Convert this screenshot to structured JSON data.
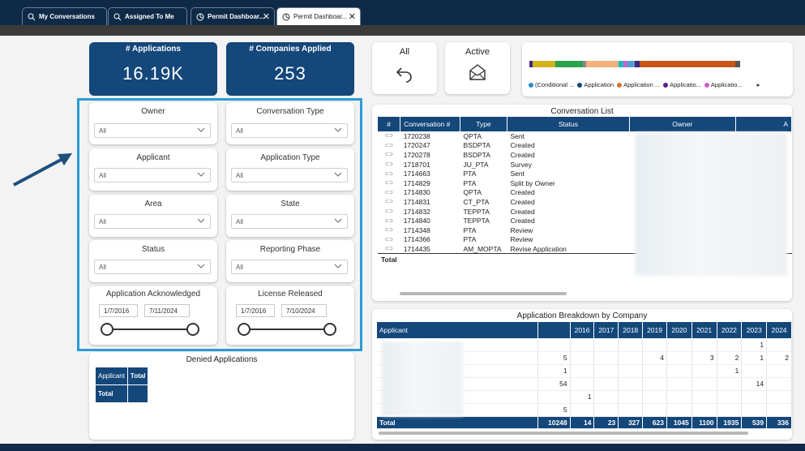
{
  "tabs": [
    {
      "label": "My Conversations",
      "icon": "search-icon"
    },
    {
      "label": "Assigned To Me",
      "icon": "search-icon"
    },
    {
      "label": "Permit Dashboar...",
      "icon": "dashboard-icon"
    },
    {
      "label": "Permit Dashboar...",
      "icon": "dashboard-icon"
    }
  ],
  "kpis": {
    "applications": {
      "label": "# Applications",
      "value": "16.19K"
    },
    "companies": {
      "label": "# Companies Applied",
      "value": "253"
    }
  },
  "filters": {
    "owner": {
      "label": "Owner",
      "value": "All"
    },
    "conversation_type": {
      "label": "Conversation Type",
      "value": "All"
    },
    "applicant": {
      "label": "Applicant",
      "value": "All"
    },
    "application_type": {
      "label": "Application Type",
      "value": "All"
    },
    "area": {
      "label": "Area",
      "value": "All"
    },
    "state": {
      "label": "State",
      "value": "All"
    },
    "status": {
      "label": "Status",
      "value": "All"
    },
    "reporting_phase": {
      "label": "Reporting Phase",
      "value": "All"
    },
    "acknowledged": {
      "label": "Application Acknowledged",
      "start": "1/7/2016",
      "end": "7/11/2024"
    },
    "license": {
      "label": "License Released",
      "start": "1/7/2016",
      "end": "7/10/2024"
    }
  },
  "denied": {
    "title": "Denied Applications",
    "col_applicant": "Applicant",
    "col_total": "Total",
    "row_total": "Total"
  },
  "buttons": {
    "all": "All",
    "active": "Active"
  },
  "legend": {
    "items": [
      {
        "label": "(Conditional ...",
        "color": "#2a8fd6"
      },
      {
        "label": "Application",
        "color": "#14477a"
      },
      {
        "label": "Application ...",
        "color": "#e0712b"
      },
      {
        "label": "Applicatio...",
        "color": "#5b1f8a"
      },
      {
        "label": "Applicatio...",
        "color": "#d25cc7"
      }
    ],
    "more": "▸"
  },
  "conversation_list": {
    "title": "Conversation List",
    "headers": [
      "#",
      "Conversation #",
      "Type",
      "Status",
      "Owner",
      "A"
    ],
    "rows": [
      [
        "1720238",
        "QPTA",
        "Sent"
      ],
      [
        "1720247",
        "BSDPTA",
        "Created"
      ],
      [
        "1720278",
        "BSDPTA",
        "Created"
      ],
      [
        "1718701",
        "JU_PTA",
        "Survey"
      ],
      [
        "1714663",
        "PTA",
        "Sent"
      ],
      [
        "1714829",
        "PTA",
        "Split by Owner"
      ],
      [
        "1714830",
        "QPTA",
        "Created"
      ],
      [
        "1714831",
        "CT_PTA",
        "Created"
      ],
      [
        "1714832",
        "TEPPTA",
        "Created"
      ],
      [
        "1714840",
        "TEPPTA",
        "Created"
      ],
      [
        "1714348",
        "PTA",
        "Review"
      ],
      [
        "1714366",
        "PTA",
        "Review"
      ],
      [
        "1714435",
        "AM_MOPTA",
        "Revise Application"
      ]
    ],
    "total_label": "Total"
  },
  "breakdown": {
    "title": "Application Breakdown by Company",
    "headers": [
      "Applicant",
      "",
      "2016",
      "2017",
      "2018",
      "2019",
      "2020",
      "2021",
      "2022",
      "2023",
      "2024"
    ],
    "rows": [
      [
        "",
        "",
        "",
        "",
        "",
        "",
        "",
        "",
        "1",
        ""
      ],
      [
        "5",
        "",
        "",
        "",
        "4",
        "",
        "3",
        "2",
        "1",
        "2"
      ],
      [
        "1",
        "",
        "",
        "",
        "",
        "",
        "",
        "1",
        "",
        ""
      ],
      [
        "54",
        "",
        "",
        "",
        "",
        "",
        "",
        "",
        "14",
        ""
      ],
      [
        "",
        "1",
        "",
        "",
        "",
        "",
        "",
        "",
        "",
        ""
      ],
      [
        "5",
        "",
        "",
        "",
        "",
        "",
        "",
        "",
        "",
        ""
      ]
    ],
    "total": [
      "Total",
      "10248",
      "14",
      "23",
      "327",
      "623",
      "1045",
      "1100",
      "1935",
      "539",
      "336"
    ]
  }
}
